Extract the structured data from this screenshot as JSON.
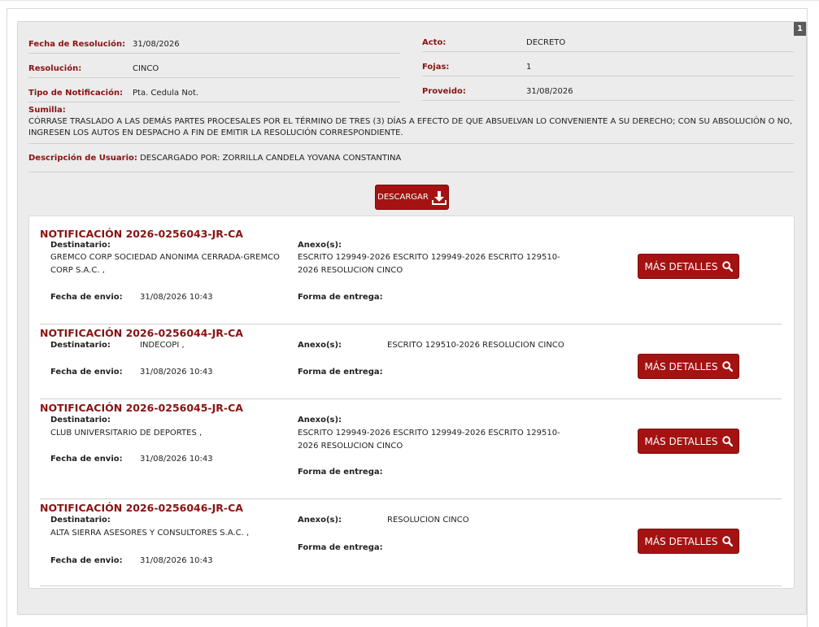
{
  "panel": {
    "badge": "1",
    "fecha_resolucion_label": "Fecha de Resolución:",
    "fecha_resolucion": "31/08/2026",
    "resolucion_label": "Resolución:",
    "resolucion": "CINCO",
    "tipo_notificacion_label": "Tipo de Notificación:",
    "tipo_notificacion": "Pta. Cedula Not.",
    "acto_label": "Acto:",
    "acto": "DECRETO",
    "fojas_label": "Fojas:",
    "fojas": "1",
    "proveido_label": "Proveido:",
    "proveido": "31/08/2026",
    "sumilla_label": "Sumilla:",
    "sumilla": "CÓRRASE TRASLADO A LAS DEMÁS PARTES PROCESALES POR EL TÉRMINO DE TRES (3) DÍAS A EFECTO DE QUE ABSUELVAN LO CONVENIENTE A SU DERECHO; CON SU ABSOLUCIÓN O NO, INGRESEN LOS AUTOS EN DESPACHO A FIN DE EMITIR LA RESOLUCIÓN CORRESPONDIENTE.",
    "descripcion_label": "Descripción de Usuario:",
    "descripcion": "DESCARGADO POR: ZORRILLA CANDELA YOVANA CONSTANTINA",
    "descargar_label": "DESCARGAR"
  },
  "labels": {
    "destinatario": "Destinatario:",
    "anexos": "Anexo(s):",
    "fecha_envio": "Fecha de envio:",
    "forma_entrega": "Forma de entrega:",
    "mas_detalles": "MÁS DETALLES"
  },
  "notifications": [
    {
      "title": "NOTIFICACIÓN 2026-0256043-JR-CA",
      "destinatario": "GREMCO CORP SOCIEDAD ANONIMA CERRADA-GREMCO CORP S.A.C. ,",
      "anexos": "ESCRITO 129949-2026 ESCRITO 129949-2026 ESCRITO 129510-2026 RESOLUCION CINCO",
      "fecha_envio": "31/08/2026 10:43",
      "forma_entrega": ""
    },
    {
      "title": "NOTIFICACIÓN 2026-0256044-JR-CA",
      "destinatario": "INDECOPI ,",
      "anexos": "ESCRITO 129510-2026 RESOLUCION CINCO",
      "fecha_envio": "31/08/2026 10:43",
      "forma_entrega": ""
    },
    {
      "title": "NOTIFICACIÓN 2026-0256045-JR-CA",
      "destinatario": "CLUB UNIVERSITARIO DE DEPORTES ,",
      "anexos": "ESCRITO 129949-2026 ESCRITO 129949-2026 ESCRITO 129510-2026 RESOLUCION CINCO",
      "fecha_envio": "31/08/2026 10:43",
      "forma_entrega": ""
    },
    {
      "title": "NOTIFICACIÓN 2026-0256046-JR-CA",
      "destinatario": "ALTA SIERRA ASESORES Y CONSULTORES S.A.C. ,",
      "anexos": "RESOLUCION CINCO",
      "fecha_envio": "31/08/2026 10:43",
      "forma_entrega": ""
    }
  ],
  "colors": {
    "accent": "#a51212",
    "label": "#8a1212",
    "panel": "#ececec"
  },
  "icons": {
    "download": "download-icon",
    "search": "search-icon"
  }
}
